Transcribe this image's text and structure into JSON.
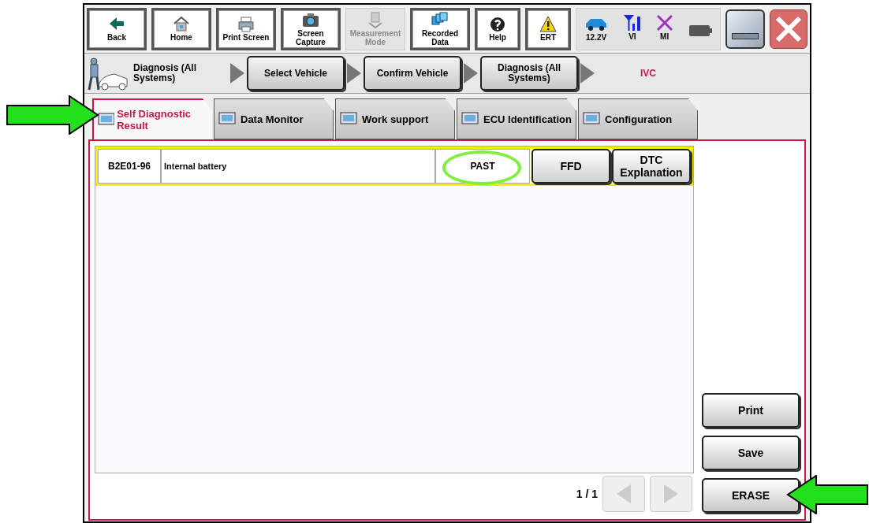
{
  "toolbar": [
    {
      "label": "Back",
      "disabled": false
    },
    {
      "label": "Home",
      "disabled": false
    },
    {
      "label": "Print Screen",
      "disabled": false
    },
    {
      "label": "Screen Capture",
      "disabled": false
    },
    {
      "label": "Measurement Mode",
      "disabled": true
    },
    {
      "label": "Recorded Data",
      "disabled": false
    },
    {
      "label": "Help",
      "disabled": false
    },
    {
      "label": "ERT",
      "disabled": false
    }
  ],
  "status": [
    {
      "label": "12.2V",
      "kind": "car"
    },
    {
      "label": "VI",
      "kind": "signal"
    },
    {
      "label": "MI",
      "kind": "cross"
    },
    {
      "kind": "battery"
    }
  ],
  "breadcrumb": [
    {
      "kind": "label",
      "text": "Diagnosis (All Systems)"
    },
    {
      "kind": "button",
      "text": "Select Vehicle"
    },
    {
      "kind": "button",
      "text": "Confirm Vehicle"
    },
    {
      "kind": "button",
      "text": "Diagnosis (All Systems)"
    },
    {
      "kind": "current",
      "text": "IVC"
    }
  ],
  "tabs": [
    {
      "label": "Self Diagnostic Result",
      "selected": true
    },
    {
      "label": "Data Monitor",
      "selected": false
    },
    {
      "label": "Work support",
      "selected": false
    },
    {
      "label": "ECU Identification",
      "selected": false
    },
    {
      "label": "Configuration",
      "selected": false
    }
  ],
  "dtc_rows": [
    {
      "code": "B2E01-96",
      "description": "Internal battery",
      "status": "PAST",
      "highlighted": true,
      "buttons": [
        "FFD",
        "DTC Explanation"
      ]
    }
  ],
  "page_indicator": "1 / 1",
  "side_buttons": [
    "Print",
    "Save",
    "ERASE"
  ]
}
